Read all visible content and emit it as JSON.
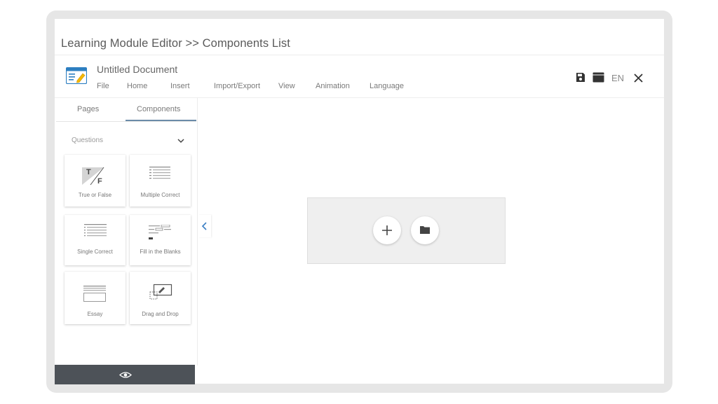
{
  "breadcrumb": "Learning Module Editor >> Components List",
  "document": {
    "title": "Untitled Document"
  },
  "menu": [
    "File",
    "Home",
    "Insert",
    "Import/Export",
    "View",
    "Animation",
    "Language"
  ],
  "toolbar": {
    "language": "EN",
    "icons": [
      "save-icon",
      "window-icon",
      "close-icon"
    ]
  },
  "sidebar": {
    "tabs": [
      {
        "label": "Pages",
        "active": false
      },
      {
        "label": "Components",
        "active": true
      }
    ],
    "section": {
      "label": "Questions",
      "expanded": true
    },
    "components": [
      {
        "label": "True or False",
        "icon": "true-false-icon"
      },
      {
        "label": "Multiple Correct",
        "icon": "multiple-correct-icon"
      },
      {
        "label": "Single Correct",
        "icon": "single-correct-icon"
      },
      {
        "label": "Fill in the Blanks",
        "icon": "fill-blanks-icon"
      },
      {
        "label": "Essay",
        "icon": "essay-icon"
      },
      {
        "label": "Drag and Drop",
        "icon": "drag-drop-icon"
      }
    ]
  },
  "colors": {
    "tab_accent": "#6b8ba8",
    "preview_bar": "#4d5258",
    "frame": "#e6e6e6",
    "dropzone": "#efefef"
  }
}
